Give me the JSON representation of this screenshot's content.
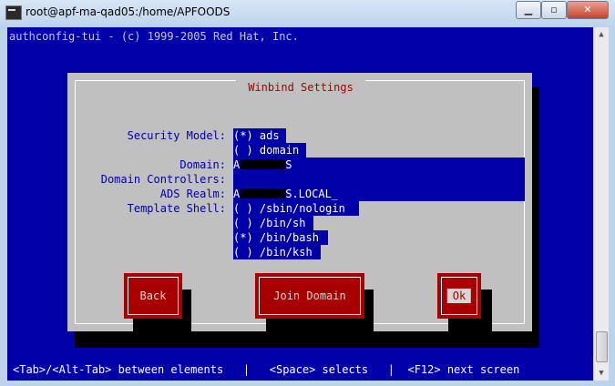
{
  "window": {
    "title": "root@apf-ma-qad05:/home/APFOODS",
    "min_glyph": "▁",
    "max_glyph": "▫",
    "close_glyph": "✕"
  },
  "terminal": {
    "header": "authconfig-tui - (c) 1999-2005 Red Hat, Inc.",
    "footer": "<Tab>/<Alt-Tab> between elements   |   <Space> selects   |  <F12> next screen"
  },
  "dialog": {
    "title": " Winbind Settings ",
    "security_model": {
      "label": "Security Model:",
      "options": [
        {
          "text": "(*) ads",
          "selected": true
        },
        {
          "text": "( ) domain",
          "selected": false
        }
      ]
    },
    "domain": {
      "label": "Domain:",
      "prefix": "A",
      "suffix": "S"
    },
    "domain_controllers": {
      "label": "Domain Controllers:",
      "value": ""
    },
    "ads_realm": {
      "label": "ADS Realm:",
      "prefix": "A",
      "suffix": "S.LOCAL_"
    },
    "template_shell": {
      "label": "Template Shell:",
      "options": [
        {
          "text": "( ) /sbin/nologin",
          "selected": false
        },
        {
          "text": "( ) /bin/sh",
          "selected": false
        },
        {
          "text": "(*) /bin/bash",
          "selected": true
        },
        {
          "text": "( ) /bin/ksh",
          "selected": false
        }
      ]
    },
    "buttons": {
      "back": "Back",
      "join_domain": "Join Domain",
      "ok": "Ok"
    }
  },
  "colors": {
    "terminal_bg": "#0000a8",
    "dialog_bg": "#c0c0c0",
    "button_bg": "#a80000",
    "title_text": "#a80000"
  }
}
